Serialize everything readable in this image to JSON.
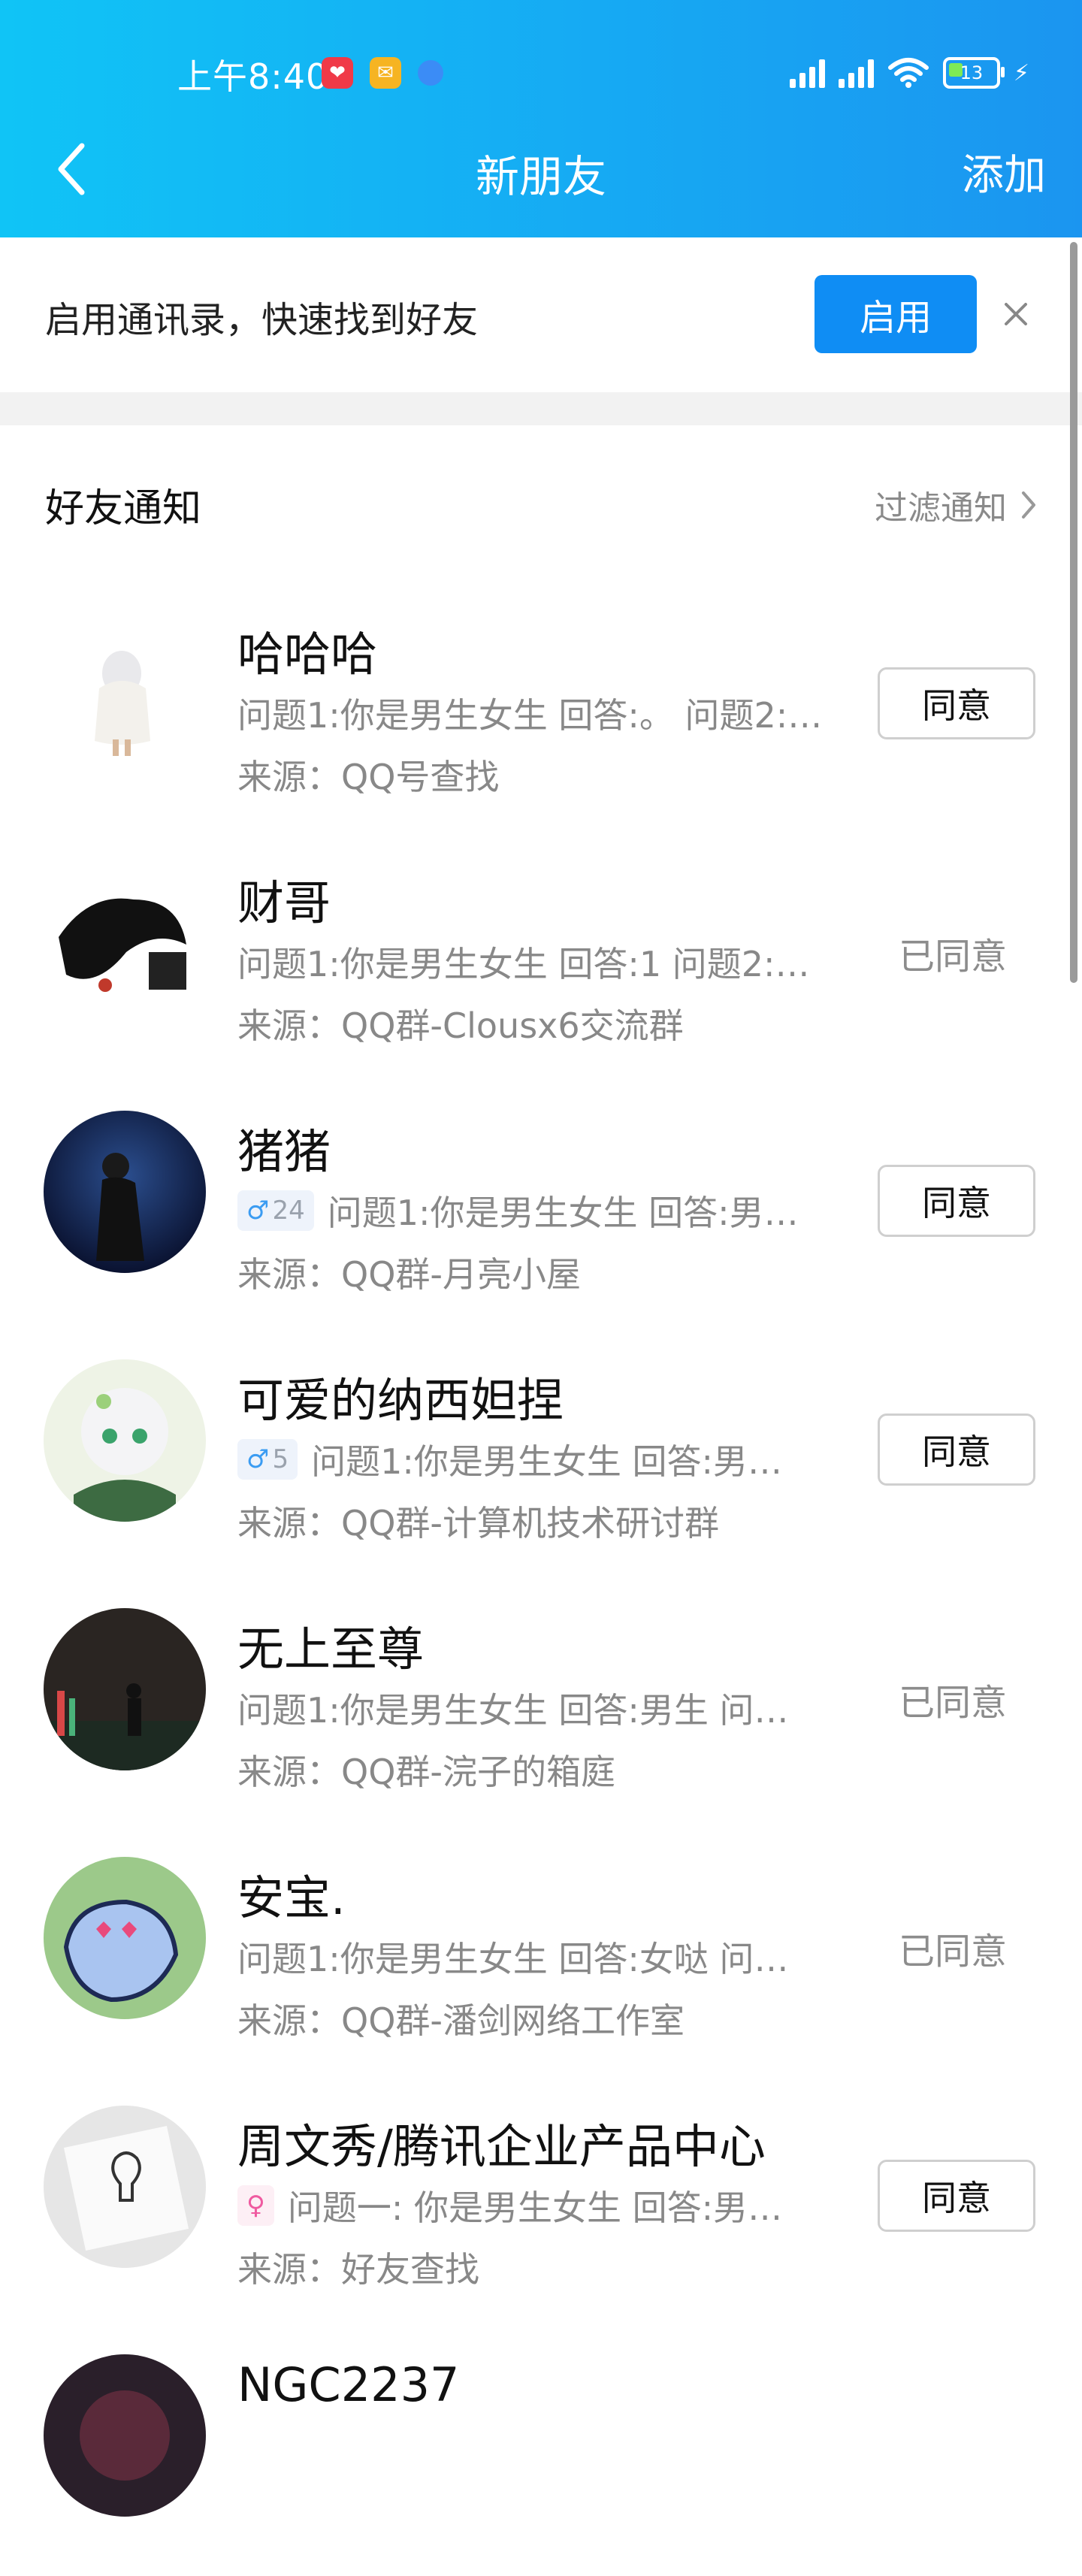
{
  "status_bar": {
    "time": "上午8:40",
    "battery": "13"
  },
  "header": {
    "title": "新朋友",
    "add_label": "添加"
  },
  "banner": {
    "text": "启用通讯录，快速找到好友",
    "enable_label": "启用"
  },
  "section": {
    "title": "好友通知",
    "filter_label": "过滤通知"
  },
  "requests": [
    {
      "name": "哈哈哈",
      "badge": null,
      "question": "问题1:你是男生女生 回答:。 问题2:…",
      "source": "来源：QQ号查找",
      "status": "同意",
      "agreed": false
    },
    {
      "name": "财哥",
      "badge": null,
      "question": "问题1:你是男生女生 回答:1 问题2:…",
      "source": "来源：QQ群-Clousx6交流群",
      "status": "已同意",
      "agreed": true
    },
    {
      "name": "猪猪",
      "badge": {
        "sex": "♂",
        "age": "24"
      },
      "question": "问题1:你是男生女生 回答:男…",
      "source": "来源：QQ群-月亮小屋",
      "status": "同意",
      "agreed": false
    },
    {
      "name": "可爱的纳西妲捏",
      "badge": {
        "sex": "♂",
        "age": "5"
      },
      "question": "问题1:你是男生女生 回答:男…",
      "source": "来源：QQ群-计算机技术研讨群",
      "status": "同意",
      "agreed": false
    },
    {
      "name": "无上至尊",
      "badge": null,
      "question": "问题1:你是男生女生 回答:男生 问…",
      "source": "来源：QQ群-浣子的箱庭",
      "status": "已同意",
      "agreed": true
    },
    {
      "name": "安宝.",
      "badge": null,
      "question": "问题1:你是男生女生 回答:女哒 问…",
      "source": "来源：QQ群-潘剑网络工作室",
      "status": "已同意",
      "agreed": true
    },
    {
      "name": "周文秀/腾讯企业产品中心",
      "badge": {
        "sex": "♀",
        "age": ""
      },
      "question": "问题一: 你是男生女生 回答:男…",
      "source": "来源：好友查找",
      "status": "同意",
      "agreed": false
    },
    {
      "name": "NGC2237",
      "badge": null,
      "question": "",
      "source": "",
      "status": "",
      "agreed": false
    }
  ],
  "colors": {
    "header_gradient_start": "#10c4f6",
    "header_gradient_end": "#1b95f0",
    "primary_button": "#0f8df4",
    "secondary_text": "#888888"
  }
}
